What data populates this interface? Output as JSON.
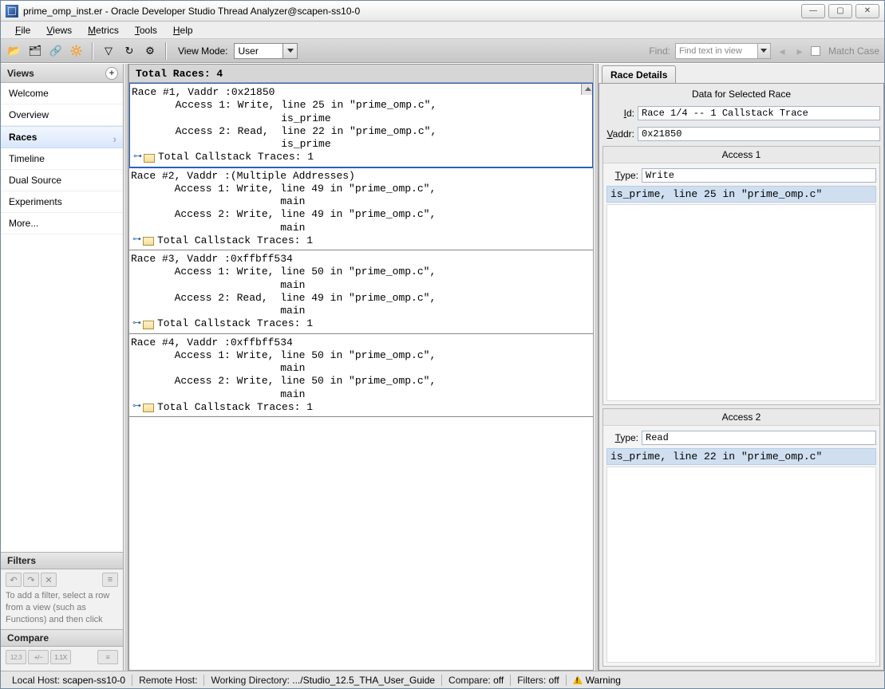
{
  "window": {
    "title": "prime_omp_inst.er  -  Oracle Developer Studio Thread Analyzer@scapen-ss10-0"
  },
  "menu": {
    "file": "File",
    "views": "Views",
    "metrics": "Metrics",
    "tools": "Tools",
    "help": "Help"
  },
  "toolbar": {
    "viewmode_label": "View Mode:",
    "viewmode_value": "User",
    "find_label": "Find:",
    "find_placeholder": "Find text in view",
    "match_case": "Match Case"
  },
  "sidebar": {
    "views_header": "Views",
    "items": [
      {
        "label": "Welcome"
      },
      {
        "label": "Overview"
      },
      {
        "label": "Races",
        "selected": true
      },
      {
        "label": "Timeline"
      },
      {
        "label": "Dual Source"
      },
      {
        "label": "Experiments"
      },
      {
        "label": "More..."
      }
    ],
    "filters_header": "Filters",
    "filters_hint": "To add a filter, select a row from a view (such as Functions) and then click",
    "compare_header": "Compare"
  },
  "races": {
    "header": "Total Races: 4",
    "items": [
      {
        "title": "Race #1, Vaddr :0x21850",
        "a1": "       Access 1: Write, line 25 in \"prime_omp.c\",",
        "a1b": "                        is_prime",
        "a2": "       Access 2: Read,  line 22 in \"prime_omp.c\",",
        "a2b": "                        is_prime",
        "traces": "Total Callstack Traces: 1",
        "selected": true
      },
      {
        "title": "Race #2, Vaddr :(Multiple Addresses)",
        "a1": "       Access 1: Write, line 49 in \"prime_omp.c\",",
        "a1b": "                        main",
        "a2": "       Access 2: Write, line 49 in \"prime_omp.c\",",
        "a2b": "                        main",
        "traces": "Total Callstack Traces: 1"
      },
      {
        "title": "Race #3, Vaddr :0xffbff534",
        "a1": "       Access 1: Write, line 50 in \"prime_omp.c\",",
        "a1b": "                        main",
        "a2": "       Access 2: Read,  line 49 in \"prime_omp.c\",",
        "a2b": "                        main",
        "traces": "Total Callstack Traces: 1"
      },
      {
        "title": "Race #4, Vaddr :0xffbff534",
        "a1": "       Access 1: Write, line 50 in \"prime_omp.c\",",
        "a1b": "                        main",
        "a2": "       Access 2: Write, line 50 in \"prime_omp.c\",",
        "a2b": "                        main",
        "traces": "Total Callstack Traces: 1"
      }
    ]
  },
  "details": {
    "tab": "Race Details",
    "selected_header": "Data for Selected Race",
    "id_label": "Id:",
    "id_value": "Race 1/4 -- 1 Callstack Trace",
    "vaddr_label": "Vaddr:",
    "vaddr_value": "0x21850",
    "access1": {
      "title": "Access 1",
      "type_label": "Type:",
      "type_value": "Write",
      "stack": "is_prime, line 25 in \"prime_omp.c\""
    },
    "access2": {
      "title": "Access 2",
      "type_label": "Type:",
      "type_value": "Read",
      "stack": "is_prime, line 22 in \"prime_omp.c\""
    }
  },
  "status": {
    "local_host_lbl": "Local Host:",
    "local_host": "scapen-ss10-0",
    "remote_host_lbl": "Remote Host:",
    "remote_host": "",
    "wd_lbl": "Working Directory:",
    "wd": ".../Studio_12.5_THA_User_Guide",
    "compare_lbl": "Compare:",
    "compare": "off",
    "filters_lbl": "Filters:",
    "filters": "off",
    "warning": "Warning"
  }
}
